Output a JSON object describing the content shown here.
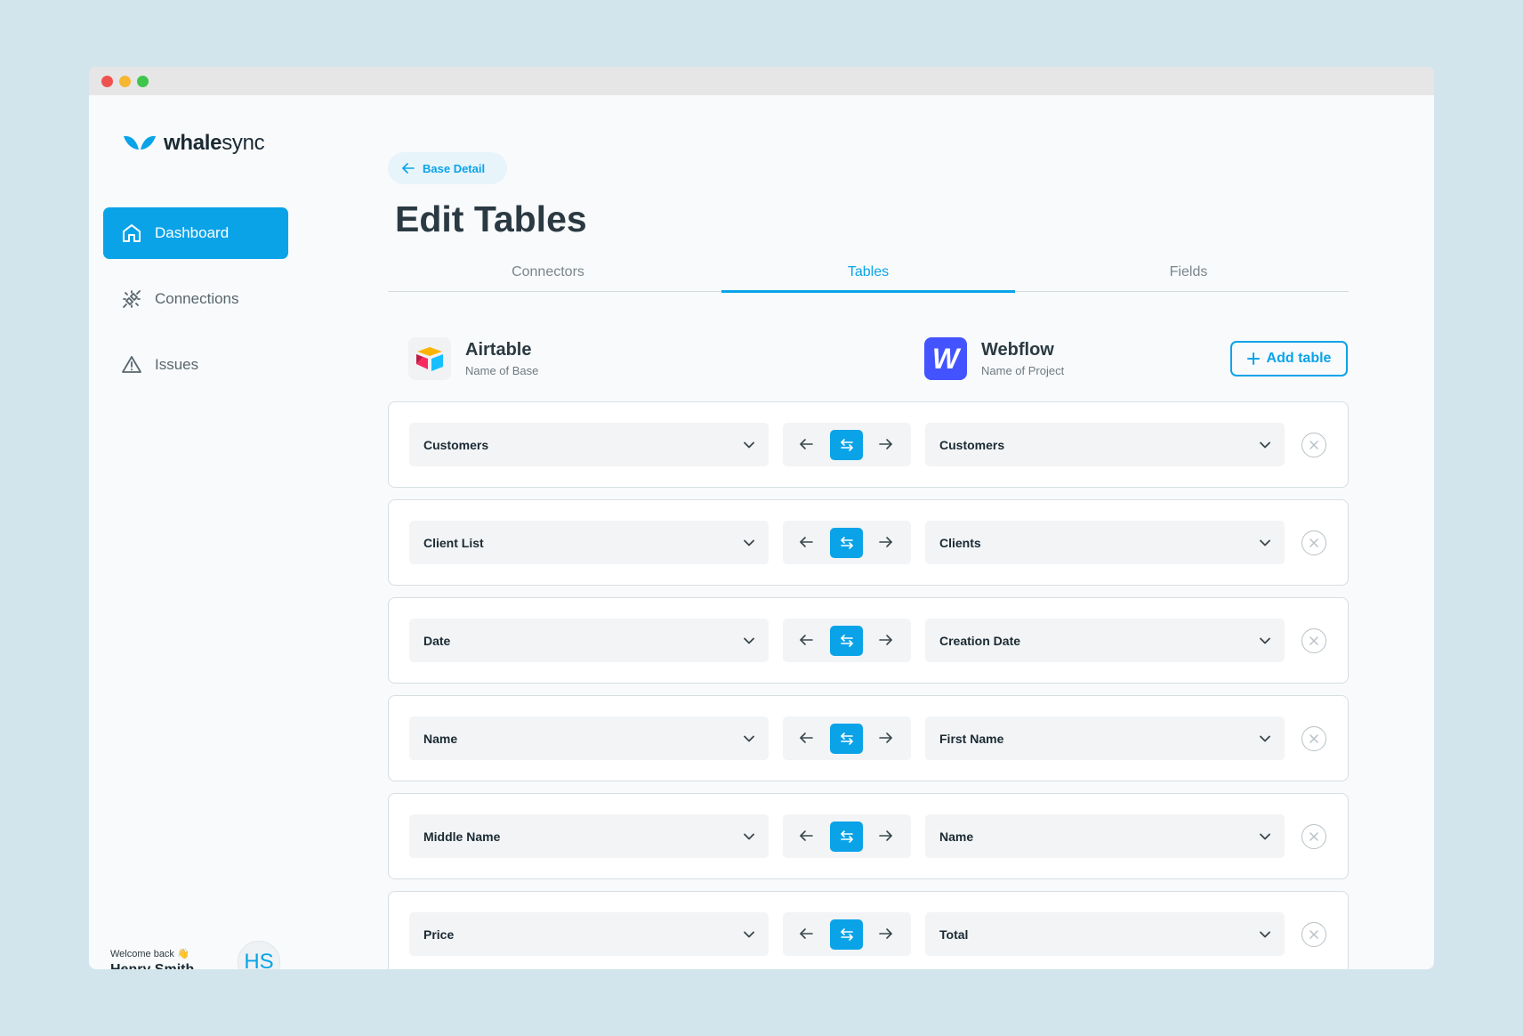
{
  "brand": {
    "name_bold": "whale",
    "name_rest": "sync",
    "color": "#0aa3e8"
  },
  "sidebar": {
    "items": [
      {
        "label": "Dashboard",
        "icon": "home-icon",
        "active": true
      },
      {
        "label": "Connections",
        "icon": "plug-disconnected-icon",
        "active": false
      },
      {
        "label": "Issues",
        "icon": "warning-triangle-icon",
        "active": false
      }
    ],
    "welcome_text": "Welcome back 👋",
    "user_name": "Henry Smith",
    "avatar_initials": "HS"
  },
  "header": {
    "back_label": "Base Detail",
    "title": "Edit Tables"
  },
  "tabs": [
    {
      "label": "Connectors",
      "active": false
    },
    {
      "label": "Tables",
      "active": true
    },
    {
      "label": "Fields",
      "active": false
    }
  ],
  "source_app": {
    "name": "Airtable",
    "subtitle": "Name of Base",
    "icon": "airtable-logo-icon"
  },
  "target_app": {
    "name": "Webflow",
    "subtitle": "Name of Project",
    "icon": "webflow-logo-icon",
    "icon_letter": "W"
  },
  "add_table_label": "Add table",
  "mappings": [
    {
      "source": "Customers",
      "target": "Customers"
    },
    {
      "source": "Client List",
      "target": "Clients"
    },
    {
      "source": "Date",
      "target": "Creation Date"
    },
    {
      "source": "Name",
      "target": "First Name"
    },
    {
      "source": "Middle Name",
      "target": "Name"
    },
    {
      "source": "Price",
      "target": "Total"
    }
  ]
}
